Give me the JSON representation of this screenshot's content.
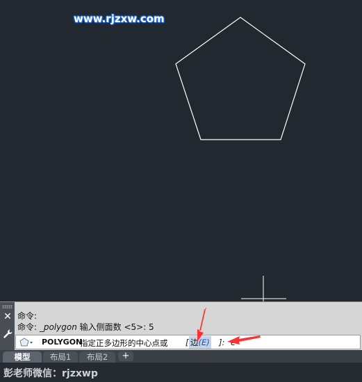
{
  "watermark": "www.rjzxw.com",
  "command_line": {
    "history": [
      {
        "text": "命令:"
      },
      {
        "prefix": "命令: ",
        "command": "_polygon",
        "rest": " 输入侧面数 <5>: 5"
      }
    ],
    "input": {
      "command_name": "POLYGON",
      "prompt": "指定正多边形的中心点或",
      "bracket_open": "[",
      "option_label": "边",
      "option_key": "(E)",
      "bracket_close": "]:",
      "typed_value": "e"
    }
  },
  "tabs": [
    {
      "label": "模型",
      "active": true
    },
    {
      "label": "布局1",
      "active": false
    },
    {
      "label": "布局2",
      "active": false
    }
  ],
  "tab_add_label": "+",
  "footer_text": "彭老师微信：rjzxwp",
  "colors": {
    "canvas_background": "#212830",
    "drawing_line": "#ffffff",
    "annotation_arrow": "#ff3030",
    "command_panel": "#d6d6d6"
  },
  "icons": {
    "close": "close-icon",
    "settings": "wrench-icon",
    "command_selector": "polygon-icon"
  }
}
